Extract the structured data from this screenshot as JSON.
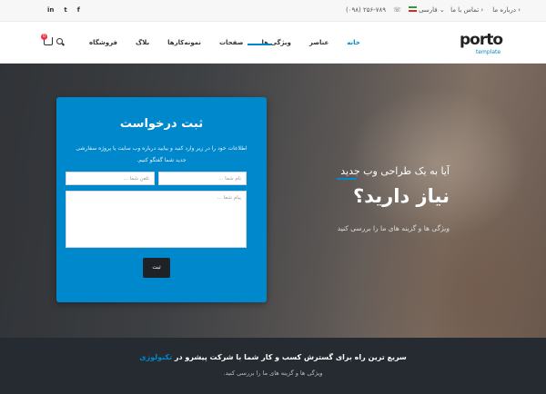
{
  "topbar": {
    "social": [
      "in",
      "t",
      "f"
    ],
    "lang": "فارسی",
    "lang_caret": "⌄",
    "phone": "(۰۹۸) ۲۵۶-۷۸۹",
    "phone_icon": "☏",
    "contact": "تماس با ما",
    "about": "درباره ما",
    "link_bullet": "›"
  },
  "header": {
    "logo": "porto",
    "logo_sub": "template",
    "cart_count": "0",
    "nav": [
      "خانه",
      "عناصر",
      "ویژگی ها",
      "صفحات",
      "نمونه‌کارها",
      "بلاگ",
      "فروشگاه"
    ]
  },
  "hero": {
    "small_title": "آیا به یک طراحی وب جدید",
    "big_title": "نیاز دارید؟",
    "subtitle": "ویژگی ها و گزینه های ما را بررسی کنید"
  },
  "form": {
    "title": "ثبت درخواست",
    "desc": "اطلاعات خود را در زیر وارد کنید و بیایید درباره وب سایت یا پروژه سفارشی جدید شما گفتگو کنیم.",
    "name_placeholder": "نام شما ...",
    "phone_placeholder": "تلفن شما ...",
    "message_placeholder": "پیام شما ...",
    "submit": "ثبت"
  },
  "footer": {
    "main_text": "سریع ترین راه برای گسترش کسب و کار شما با شرکت پیشرو در",
    "accent_word": "تکنولوژی",
    "sub_text": "ویژگی ها و گزینه های ما را بررسی کنید."
  },
  "colors": {
    "accent": "#0088cc",
    "footer_bg": "#262a31",
    "button_dark": "#1e2227"
  }
}
